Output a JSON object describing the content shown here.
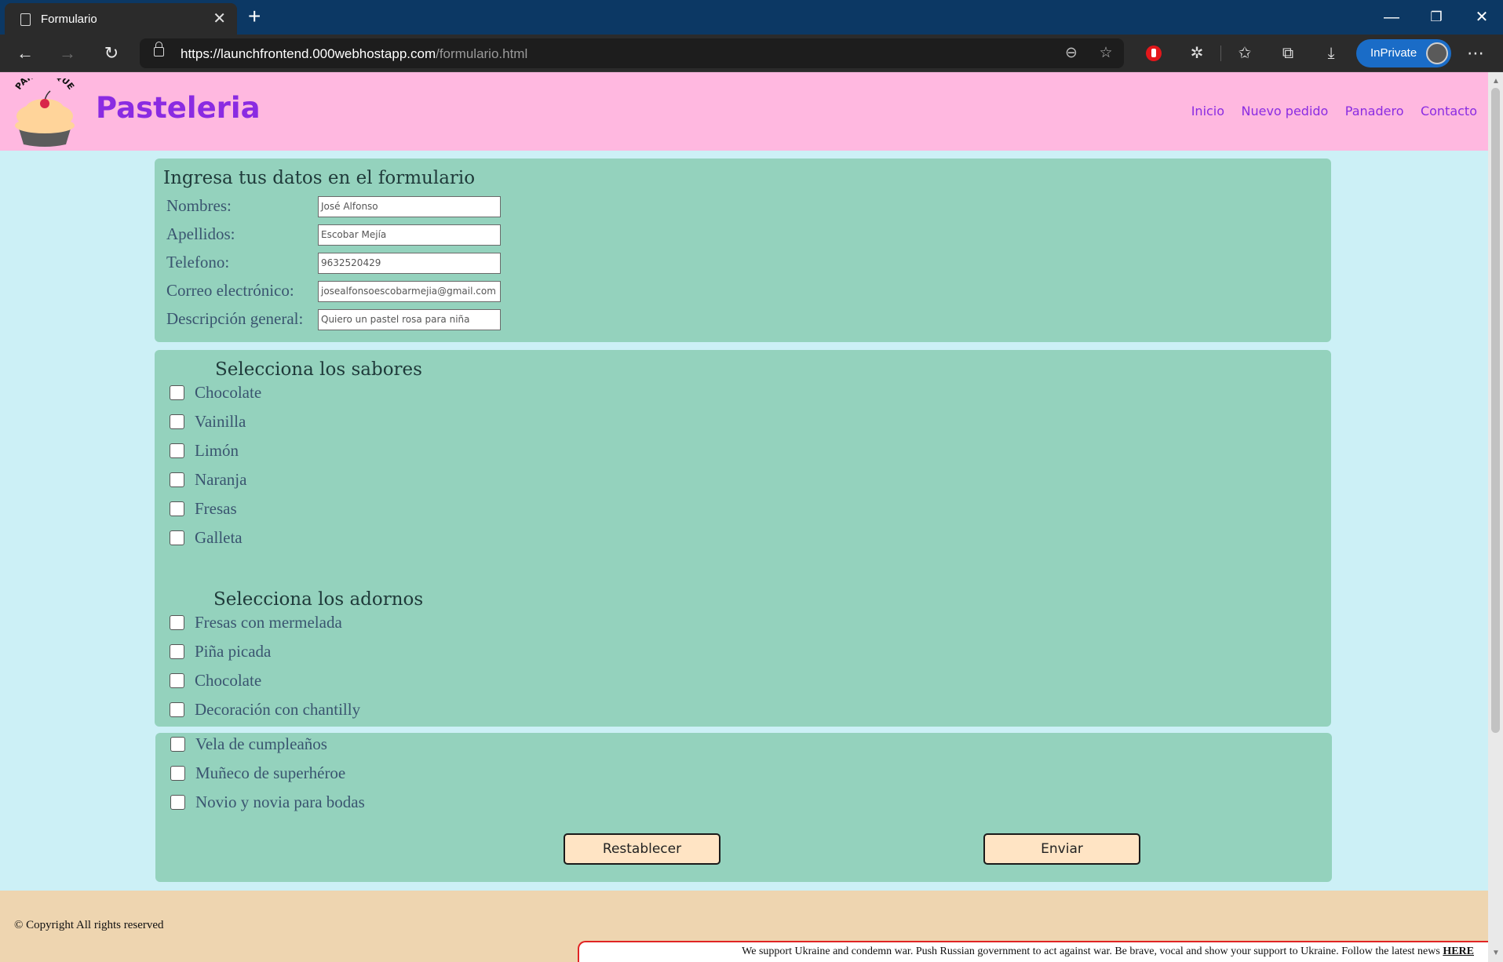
{
  "browser": {
    "tab_title": "Formulario",
    "url_host": "https://launchfrontend.000webhostapp.com",
    "url_path": "/formulario.html",
    "inprivate_label": "InPrivate"
  },
  "site": {
    "logo_text": "PANQUEQUE",
    "title": "Pasteleria",
    "nav": [
      "Inicio",
      "Nuevo pedido",
      "Panadero",
      "Contacto"
    ]
  },
  "datos": {
    "heading": "Ingresa tus datos en el formulario",
    "fields": [
      {
        "label": "Nombres:",
        "value": "José Alfonso"
      },
      {
        "label": "Apellidos:",
        "value": "Escobar Mejía"
      },
      {
        "label": "Telefono:",
        "value": "9632520429"
      },
      {
        "label": "Correo electrónico:",
        "value": "josealfonsoescobarmejia@gmail.com"
      },
      {
        "label": "Descripción general:",
        "value": "Quiero un pastel rosa para niña"
      }
    ]
  },
  "sabores": {
    "heading": "Selecciona los sabores",
    "options": [
      "Chocolate",
      "Vainilla",
      "Limón",
      "Naranja",
      "Fresas",
      "Galleta"
    ]
  },
  "adornos": {
    "heading": "Selecciona los adornos",
    "options": [
      "Fresas con mermelada",
      "Piña picada",
      "Chocolate",
      "Decoración con chantilly",
      "Vela de cumpleaños",
      "Muñeco de superhéroe",
      "Novio y novia para bodas"
    ]
  },
  "buttons": {
    "reset": "Restablecer",
    "submit": "Enviar"
  },
  "footer": {
    "copyright": "© Copyright All rights reserved",
    "banner_text": "We support Ukraine and condemn war. Push Russian government to act against war. Be brave, vocal and show your support to Ukraine. Follow the latest news",
    "banner_link": "HERE"
  },
  "colors": {
    "header_bg": "#ffb8e0",
    "title_purple": "#8a2be2",
    "panel_green": "#94d2bd",
    "page_bg": "#ccf0f6",
    "button_bg": "#ffe4c4",
    "footer_bg": "#eed5b0"
  }
}
